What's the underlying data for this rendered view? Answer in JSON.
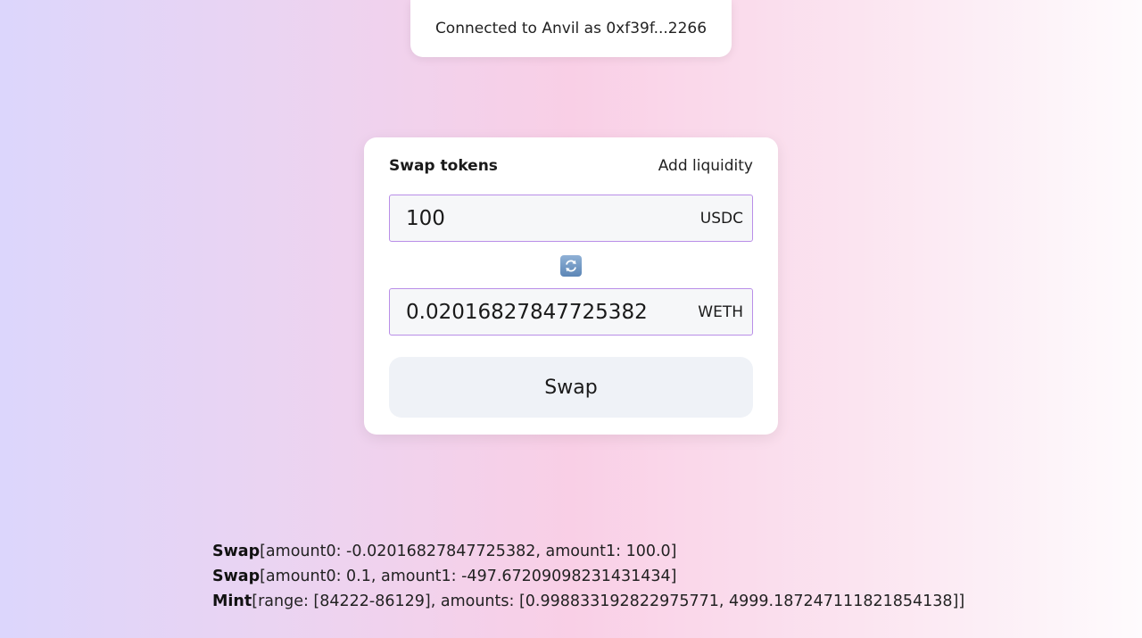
{
  "connection": {
    "text": "Connected to Anvil as 0xf39f...2266"
  },
  "swap_card": {
    "tabs": {
      "swap": "Swap tokens",
      "liquidity": "Add liquidity"
    },
    "from": {
      "value": "100",
      "token": "USDC"
    },
    "to": {
      "value": "0.02016827847725382",
      "token": "WETH"
    },
    "direction_icon": "refresh-arrows-icon",
    "swap_button": "Swap"
  },
  "events": [
    {
      "name": "Swap",
      "details": "[amount0: -0.02016827847725382, amount1: 100.0]"
    },
    {
      "name": "Swap",
      "details": "[amount0: 0.1, amount1: -497.67209098231431434]"
    },
    {
      "name": "Mint",
      "details": "[range: [84222-86129], amounts: [0.998833192822975771, 4999.187247111821854138]]"
    }
  ],
  "colors": {
    "field_border": "#b98ee8",
    "field_background": "#f6f7f9",
    "button_background": "#eff2f7",
    "icon_blue": "#5c86b6"
  }
}
